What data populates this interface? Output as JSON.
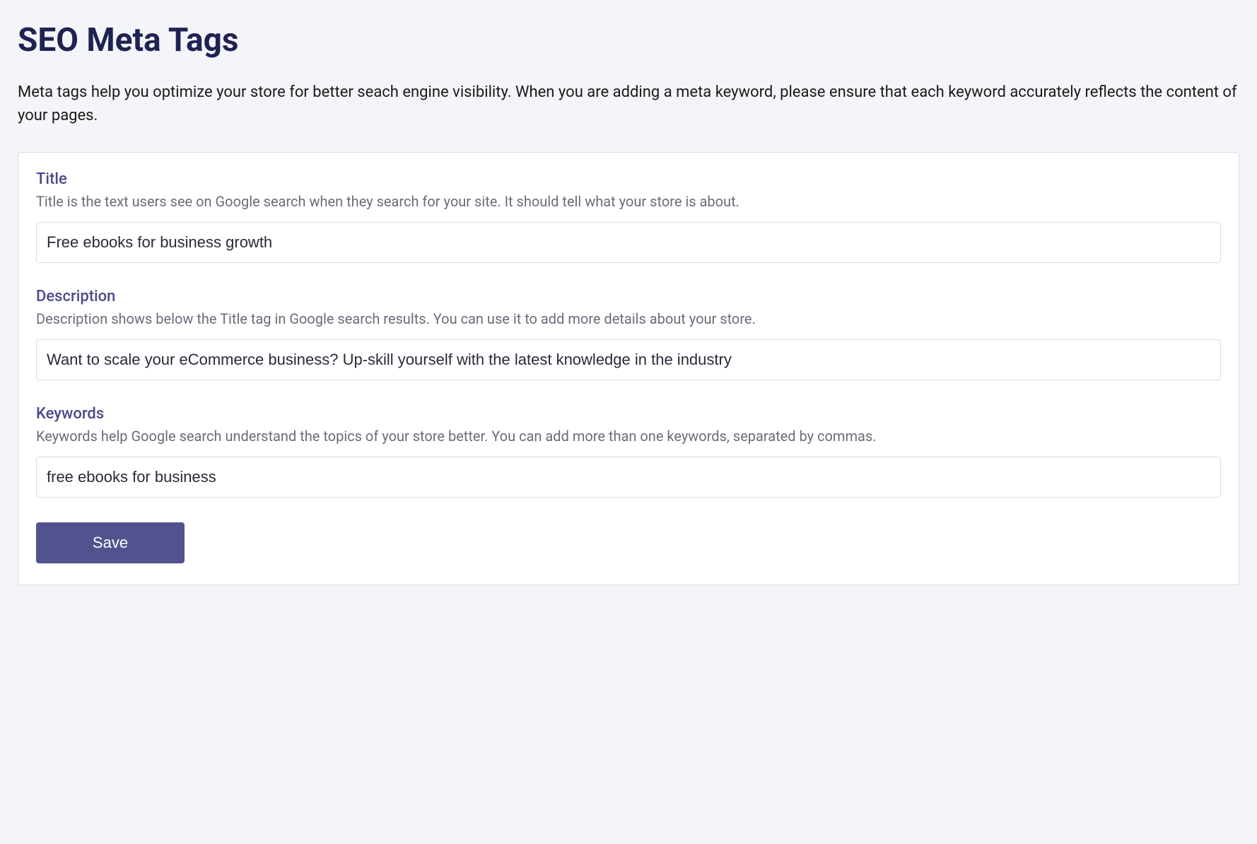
{
  "page": {
    "title": "SEO Meta Tags",
    "description": "Meta tags help you optimize your store for better seach engine visibility. When you are adding a meta keyword, please ensure that each keyword accurately reflects the content of your pages."
  },
  "form": {
    "title": {
      "label": "Title",
      "help": "Title is the text users see on Google search when they search for your site. It should tell what your store is about.",
      "value": "Free ebooks for business growth"
    },
    "description": {
      "label": "Description",
      "help": "Description shows below the Title tag in Google search results. You can use it to add more details about your store.",
      "value": "Want to scale your eCommerce business? Up-skill yourself with the latest knowledge in the industry"
    },
    "keywords": {
      "label": "Keywords",
      "help": "Keywords help Google search understand the topics of your store better. You can add more than one keywords, separated by commas.",
      "value": "free ebooks for business"
    },
    "save_label": "Save"
  }
}
